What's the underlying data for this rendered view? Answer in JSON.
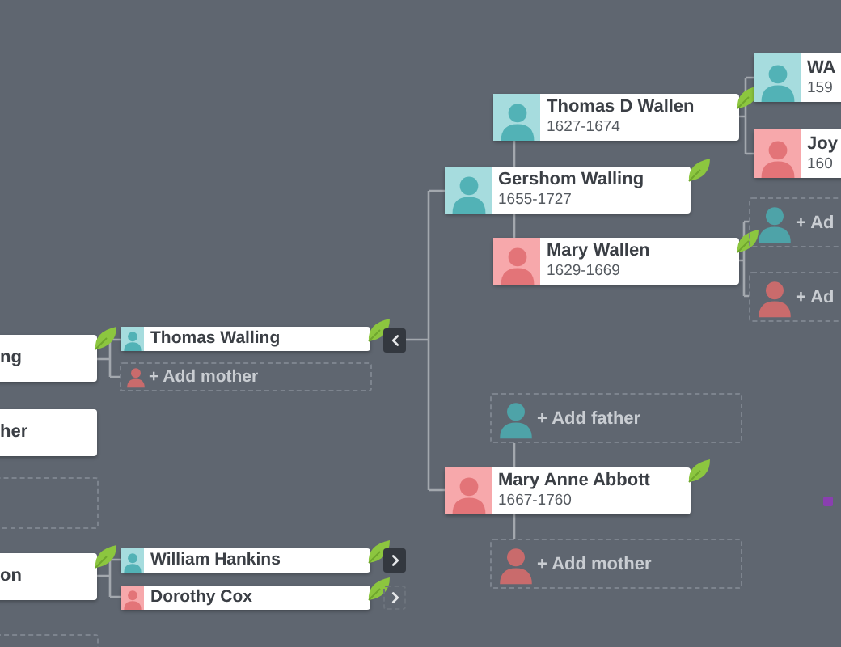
{
  "generation_1": [
    {
      "kind": "stub",
      "name": "ng",
      "leaf": true
    },
    {
      "kind": "stub",
      "name": "her",
      "leaf": false
    },
    {
      "kind": "empty"
    },
    {
      "kind": "stub",
      "name": "on",
      "leaf": true
    },
    {
      "kind": "empty"
    }
  ],
  "generation_2": [
    {
      "kind": "small",
      "female": false,
      "name": "Thomas Walling",
      "leaf": true
    },
    {
      "kind": "small-add",
      "female": true,
      "name": "+ Add mother"
    },
    {
      "kind": "small",
      "female": false,
      "name": "William Hankins",
      "leaf": true
    },
    {
      "kind": "small",
      "female": true,
      "name": "Dorothy Cox",
      "leaf": true
    }
  ],
  "generation_3": [
    {
      "kind": "card",
      "female": false,
      "name": "Gershom Walling",
      "years": "1655-1727",
      "leaf": true
    },
    {
      "kind": "card",
      "female": true,
      "name": "Mary Anne Abbott",
      "years": "1667-1760",
      "leaf": true
    }
  ],
  "generation_4": [
    {
      "kind": "card",
      "female": false,
      "name": "Thomas D Wallen",
      "years": "1627-1674",
      "leaf": true
    },
    {
      "kind": "card",
      "female": true,
      "name": "Mary Wallen",
      "years": "1629-1669",
      "leaf": true
    },
    {
      "kind": "add",
      "female": false,
      "name": "+ Add father"
    },
    {
      "kind": "add",
      "female": true,
      "name": "+ Add mother"
    }
  ],
  "generation_5": [
    {
      "kind": "card",
      "female": false,
      "name": "WA",
      "years": "159",
      "leaf": false
    },
    {
      "kind": "card",
      "female": true,
      "name": "Joy",
      "years": "160",
      "leaf": false
    },
    {
      "kind": "add",
      "female": false,
      "name": "+ Ad"
    },
    {
      "kind": "add",
      "female": true,
      "name": "+ Ad"
    }
  ],
  "expand_buttons": [
    {
      "points_left": true,
      "active": true
    },
    {
      "points_left": false,
      "active": true
    },
    {
      "points_left": false,
      "active": false
    }
  ]
}
